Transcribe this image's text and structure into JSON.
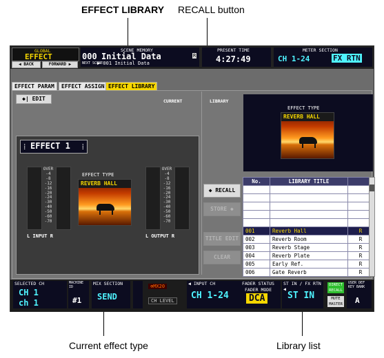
{
  "callouts": {
    "effect_library": "EFFECT LIBRARY",
    "recall_button": "RECALL button",
    "current_effect_type": "Current effect type",
    "library_list": "Library list"
  },
  "header": {
    "global_label": "GLOBAL",
    "function_name": "EFFECT",
    "back_label": "◀ BACK",
    "forward_label": "FORWARD ▶",
    "scene_memory_label": "SCENE MEMORY",
    "scene_number": "000",
    "scene_title": "Initial Data",
    "scene_r": "R",
    "next_scene_label": "NEXT SCENE",
    "next_scene": "▶ 001 Initial Data",
    "present_time_label": "PRESENT TIME",
    "present_time": "4:27:49",
    "meter_section_label": "METER SECTION",
    "meter_ch": "CH 1-24",
    "meter_fx": "FX RTN"
  },
  "tabs": [
    {
      "label": "EFFECT PARAM"
    },
    {
      "label": "EFFECT ASSIGN"
    },
    {
      "label": "EFFECT LIBRARY"
    }
  ],
  "main": {
    "edit_button": "EDIT",
    "current_label": "CURRENT",
    "library_label": "LIBRARY",
    "effect_selector": "EFFECT 1",
    "effect_type_label": "EFFECT TYPE",
    "effect_type_name": "REVERB HALL",
    "meter_ticks": [
      "OVER",
      "-4",
      "-8",
      "-12",
      "-16",
      "-20",
      "-24",
      "-30",
      "-40",
      "-50",
      "-60",
      "-70"
    ],
    "input_label": "L  INPUT  R",
    "output_label": "L  OUTPUT  R",
    "recall_button": "RECALL",
    "store_button": "STORE",
    "title_edit_button": "TITLE EDIT",
    "clear_button": "CLEAR"
  },
  "library_preview": {
    "label": "EFFECT TYPE",
    "name": "REVERB HALL"
  },
  "library_table": {
    "headers": [
      "No.",
      "LIBRARY TITLE",
      ""
    ],
    "empty_rows": 5,
    "rows": [
      {
        "no": "001",
        "title": "Reverb Hall",
        "flag": "R"
      },
      {
        "no": "002",
        "title": "Reverb Room",
        "flag": "R"
      },
      {
        "no": "003",
        "title": "Reverb Stage",
        "flag": "R"
      },
      {
        "no": "004",
        "title": "Reverb Plate",
        "flag": "R"
      },
      {
        "no": "005",
        "title": "Early Ref.",
        "flag": "R"
      },
      {
        "no": "006",
        "title": "Gate Reverb",
        "flag": "R"
      }
    ]
  },
  "status_bar": {
    "selected_ch_label": "SELECTED CH",
    "selected_ch": "CH 1",
    "selected_ch_name": "ch 1",
    "machine_id_label": "MACHINE ID",
    "machine_id_value": "#1",
    "mix_section_label": "MIX SECTION",
    "mix_value": "SEND",
    "model_badge": "⊕MX20",
    "ch_level": "CH LEVEL",
    "input_ch_label": "◀ INPUT CH",
    "input_ch": "CH 1-24",
    "fader_status_label": "FADER STATUS",
    "fader_mode_label": "FADER MODE",
    "fader_mode": "DCA",
    "st_in_label": "ST IN / FX RTN ◀",
    "st_in": "ST IN",
    "direct_recall": "DIRECT RECALL",
    "mute_master": "MUTE MASTER",
    "user_def_label": "USER DEF KEY BANK",
    "user_def_value": "A"
  }
}
